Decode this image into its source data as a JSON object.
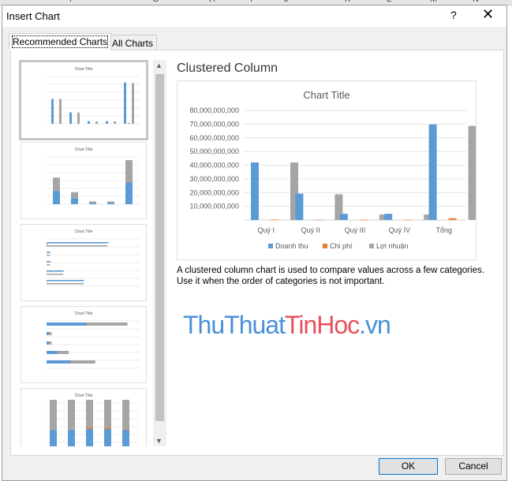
{
  "spreadsheet": {
    "columns": [
      "F",
      "G",
      "H",
      "I",
      "J",
      "K",
      "L",
      "M",
      "N"
    ]
  },
  "dialog": {
    "title": "Insert Chart",
    "help": "?",
    "close": "✕",
    "tabs": [
      {
        "label": "Recommended Charts",
        "active": true
      },
      {
        "label": "All Charts",
        "active": false
      }
    ],
    "selected_type": "Clustered Column",
    "description": "A clustered column chart is used to compare values across a few categories. Use it when the order of categories is not important.",
    "ok": "OK",
    "cancel": "Cancel",
    "thumbnails": [
      {
        "kind": "clustered-column",
        "selected": true
      },
      {
        "kind": "stacked-column"
      },
      {
        "kind": "clustered-bar"
      },
      {
        "kind": "stacked-bar"
      },
      {
        "kind": "100-stacked-column"
      }
    ],
    "thumb_title": "Chart Title"
  },
  "watermark": {
    "part1": "ThuThuat",
    "part2": "TinHoc",
    "part3": ".vn",
    "colors": [
      "#4a90d9",
      "#e8505b",
      "#4a90d9"
    ]
  },
  "chart_data": {
    "type": "bar",
    "title": "Chart Title",
    "categories": [
      "Quý I",
      "Quý II",
      "Quý III",
      "Quý IV",
      "Tổng"
    ],
    "series": [
      {
        "name": "Doanh thu",
        "color": "#5b9bd5",
        "values": [
          42000000000,
          19300000000,
          4500000000,
          4500000000,
          69800000000
        ]
      },
      {
        "name": "Chi phí",
        "color": "#ed7d31",
        "values": [
          300000000,
          200000000,
          200000000,
          200000000,
          1300000000
        ]
      },
      {
        "name": "Lợi nhuận",
        "color": "#a5a5a5",
        "values": [
          42000000000,
          18800000000,
          4000000000,
          4000000000,
          68700000000
        ]
      }
    ],
    "ylim": [
      0,
      80000000000
    ],
    "yticks": [
      "10,000,000,000",
      "20,000,000,000",
      "30,000,000,000",
      "40,000,000,000",
      "50,000,000,000",
      "60,000,000,000",
      "70,000,000,000",
      "80,000,000,000"
    ],
    "grid": true,
    "legend": "bottom"
  }
}
